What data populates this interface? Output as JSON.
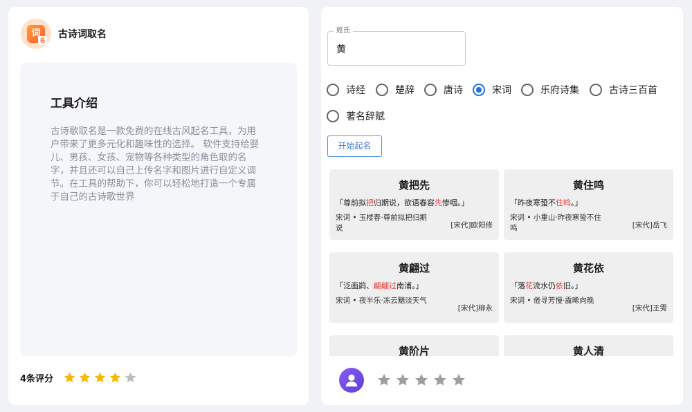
{
  "app": {
    "name": "古诗词取名",
    "logo_main": "词",
    "logo_sub": "名"
  },
  "intro": {
    "title": "工具介绍",
    "text": "古诗歌取名是一款免费的在线古风起名工具，为用户带来了更多元化和趣味性的选择。 软件支持给婴儿、男孩、女孩、宠物等各种类型的角色取的名字，并且还可以自己上传名字和图片进行自定义调节。在工具的帮助下，你可以轻松地打造一个专属于自己的古诗歌世界"
  },
  "rating": {
    "count_label": "4条评分",
    "stars_filled": 4,
    "stars_total": 5,
    "star_color": "#f5b800",
    "star_empty_color": "#bdbdbd"
  },
  "form": {
    "surname_label": "姓氏",
    "surname_value": "黄",
    "sources": [
      "诗经",
      "楚辞",
      "唐诗",
      "宋词",
      "乐府诗集",
      "古诗三百首",
      "著名辞赋"
    ],
    "selected_source": "宋词",
    "start_label": "开始起名"
  },
  "results": [
    {
      "name": "黄把先",
      "quote_parts": [
        [
          "「尊前拟",
          false
        ],
        [
          "把",
          true
        ],
        [
          "归期说，欲语春容",
          false
        ],
        [
          "先",
          true
        ],
        [
          "惨咽。」",
          false
        ]
      ],
      "source": "宋词 • 玉楼春·尊前拟把归期说",
      "author": "[宋代]欧阳修"
    },
    {
      "name": "黄住鸣",
      "quote_parts": [
        [
          "「昨夜寒蛩不",
          false
        ],
        [
          "住鸣",
          true
        ],
        [
          "。」",
          false
        ]
      ],
      "source": "宋词 • 小重山·昨夜寒蛩不住鸣",
      "author": "[宋代]岳飞"
    },
    {
      "name": "黄翩过",
      "quote_parts": [
        [
          "「泛画鹢、",
          false
        ],
        [
          "翩翩过",
          true
        ],
        [
          "南浦。」",
          false
        ]
      ],
      "source": "宋词 • 夜半乐·冻云黯淡天气",
      "author": "[宋代]柳永"
    },
    {
      "name": "黄花依",
      "quote_parts": [
        [
          "「落",
          false
        ],
        [
          "花",
          true
        ],
        [
          "流水仍",
          false
        ],
        [
          "依",
          true
        ],
        [
          "旧。」",
          false
        ]
      ],
      "source": "宋词 • 倦寻芳慢·露晞向晚",
      "author": "[宋代]王雱"
    },
    {
      "name": "黄阶片",
      "quote_parts": [],
      "source": "",
      "author": ""
    },
    {
      "name": "黄人清",
      "quote_parts": [],
      "source": "",
      "author": ""
    }
  ],
  "footer": {
    "avatar_icon": "user-icon",
    "rate_stars_total": 5
  },
  "colors": {
    "accent": "#1a73e8",
    "highlight": "#e53935",
    "avatar": "#7c4dff"
  }
}
